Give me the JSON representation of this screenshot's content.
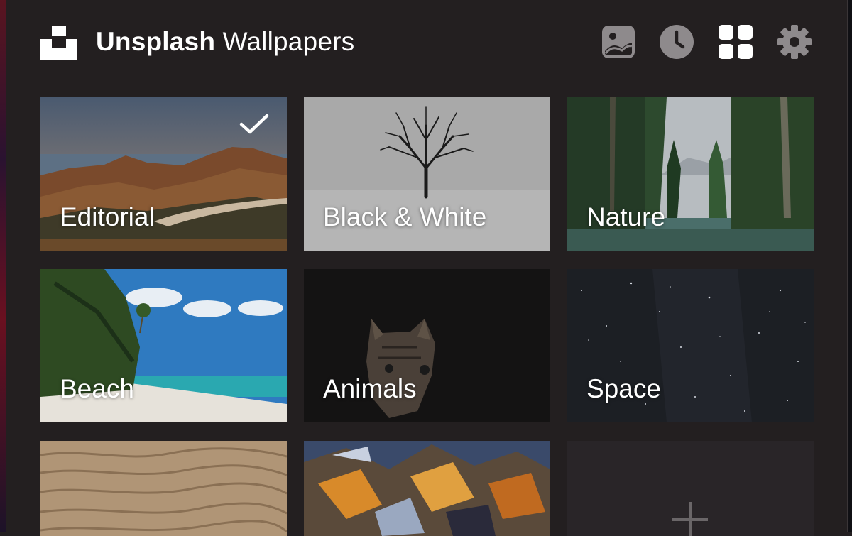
{
  "app": {
    "title_bold": "Unsplash",
    "title_light": "Wallpapers"
  },
  "toolbar": {
    "icons": [
      "photo-icon",
      "clock-icon",
      "grid-icon",
      "gear-icon"
    ],
    "active": "grid-icon"
  },
  "categories": [
    {
      "label": "Editorial",
      "selected": true
    },
    {
      "label": "Black & White",
      "selected": false
    },
    {
      "label": "Nature",
      "selected": false
    },
    {
      "label": "Beach",
      "selected": false
    },
    {
      "label": "Animals",
      "selected": false
    },
    {
      "label": "Space",
      "selected": false
    },
    {
      "label": "",
      "selected": false
    },
    {
      "label": "",
      "selected": false
    }
  ],
  "add_tile": {
    "icon": "plus-icon"
  },
  "colors": {
    "background": "#231f20",
    "icon_inactive": "#8e8a8c",
    "icon_active": "#ffffff",
    "text": "#ffffff"
  }
}
